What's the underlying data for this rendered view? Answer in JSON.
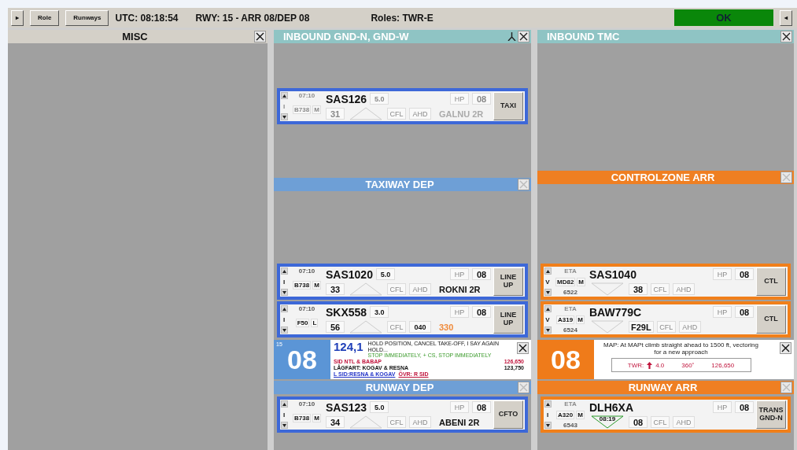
{
  "top_bar": {
    "left_button": "▸",
    "buttons": [
      "Role",
      "Runways"
    ],
    "utc": "UTC: 08:18:54",
    "runway_info": "RWY: 15 - ARR 08/DEP 08",
    "roles": "Roles: TWR-E",
    "status": "OK",
    "right_button": "◂"
  },
  "columns": [
    {
      "blocks": [
        {
          "kind": "misc_section",
          "title": "MISC"
        }
      ]
    },
    {
      "blocks": [
        {
          "kind": "inbound_section",
          "title": "INBOUND GND-N, GND-W",
          "split_icon": true,
          "strips": [
            {
              "kind": "dep",
              "faded": true,
              "time": "07:10",
              "rule": "I",
              "type": "B738",
              "wtc": "M",
              "callsign": "SAS126",
              "speed": "5.0",
              "field": "31",
              "cfl": "CFL",
              "ahd": "AHD",
              "ahd_set": false,
              "hp": "HP",
              "runway": "08",
              "sid": "GALNU 2R",
              "sid_warning": false,
              "button": "TAXI"
            }
          ]
        },
        {
          "kind": "dep_section",
          "title": "TAXIWAY DEP",
          "strips": [
            {
              "kind": "dep",
              "faded": false,
              "time": "07:10",
              "rule": "I",
              "type": "B738",
              "wtc": "M",
              "callsign": "SAS1020",
              "speed": "5.0",
              "field": "33",
              "cfl": "CFL",
              "ahd": "AHD",
              "ahd_set": false,
              "hp": "HP",
              "runway": "08",
              "sid": "ROKNI 2R",
              "sid_warning": false,
              "button": "LINE UP"
            },
            {
              "kind": "dep",
              "faded": false,
              "time": "07:10",
              "rule": "I",
              "type": "F50",
              "wtc": "L",
              "callsign": "SKX558",
              "speed": "3.0",
              "field": "56",
              "cfl": "CFL",
              "ahd": "040",
              "ahd_set": true,
              "hp": "HP",
              "runway": "08",
              "sid": "330",
              "sid_warning": true,
              "button": "LINE UP"
            }
          ]
        },
        {
          "kind": "dep_runway_panel",
          "number": "08",
          "index": "15",
          "frequency": "124,1",
          "instructions": [
            {
              "text": "HOLD POSITION, CANCEL TAKE-OFF, I SAY AGAIN HOLD...",
              "kind": "normal"
            },
            {
              "text": "STOP IMMEDIATELY, + CS, STOP IMMEDIATELY",
              "kind": "green"
            }
          ],
          "lines": [
            {
              "text": "SID NTL & BABAP",
              "kind": "red",
              "freq": "126,650"
            },
            {
              "text": "LÅGFART: KOGAV & RESNA",
              "kind": "normal",
              "freq": "123,750"
            }
          ],
          "links": [
            {
              "text": "L SID:RESNA & KOGAV",
              "kind": "blue"
            },
            {
              "text": "ÖVR: R SID",
              "kind": "red"
            }
          ]
        },
        {
          "kind": "dep_section",
          "title": "RUNWAY DEP",
          "strips": [
            {
              "kind": "dep",
              "faded": false,
              "time": "07:10",
              "rule": "I",
              "type": "B738",
              "wtc": "M",
              "callsign": "SAS123",
              "speed": "5.0",
              "field": "34",
              "cfl": "CFL",
              "ahd": "AHD",
              "ahd_set": false,
              "hp": "HP",
              "runway": "08",
              "sid": "ABENI 2R",
              "sid_warning": false,
              "button": "CFTO"
            }
          ]
        }
      ]
    },
    {
      "blocks": [
        {
          "kind": "inbound_section",
          "title": "INBOUND TMC"
        },
        {
          "kind": "arr_section",
          "title": "CONTROLZONE ARR",
          "strips": [
            {
              "kind": "arr",
              "eta": "ETA",
              "rule": "V",
              "type": "MD82",
              "wtc": "M",
              "squawk": "6522",
              "callsign": "SAS1040",
              "field": "38",
              "cfl": "CFL",
              "ahd": "AHD",
              "hp": "HP",
              "runway": "08",
              "button": "CTL"
            },
            {
              "kind": "arr",
              "eta": "ETA",
              "rule": "V",
              "type": "A319",
              "wtc": "M",
              "squawk": "6524",
              "callsign": "BAW779C",
              "field": "F29L",
              "cfl": "CFL",
              "ahd": "AHD",
              "hp": "HP",
              "runway": "08",
              "button": "CTL"
            }
          ]
        },
        {
          "kind": "arr_runway_panel",
          "number": "08",
          "message": "MAP: At MAPt climb straight ahead to 1500 ft, vectoring for a new approach",
          "twr": {
            "label": "TWR:",
            "altitude": "4.0",
            "heading": "360˚",
            "frequency": "126,650"
          }
        },
        {
          "kind": "arr_section",
          "title": "RUNWAY ARR",
          "strips": [
            {
              "kind": "arr",
              "eta": "ETA",
              "rule": "I",
              "type": "A320",
              "wtc": "M",
              "squawk": "6543",
              "callsign": "DLH6XA",
              "triangle_label": "08:19",
              "field": "08",
              "cfl": "CFL",
              "ahd": "AHD",
              "hp": "HP",
              "runway": "08",
              "button": "TRANS GND-N"
            }
          ]
        }
      ]
    }
  ]
}
